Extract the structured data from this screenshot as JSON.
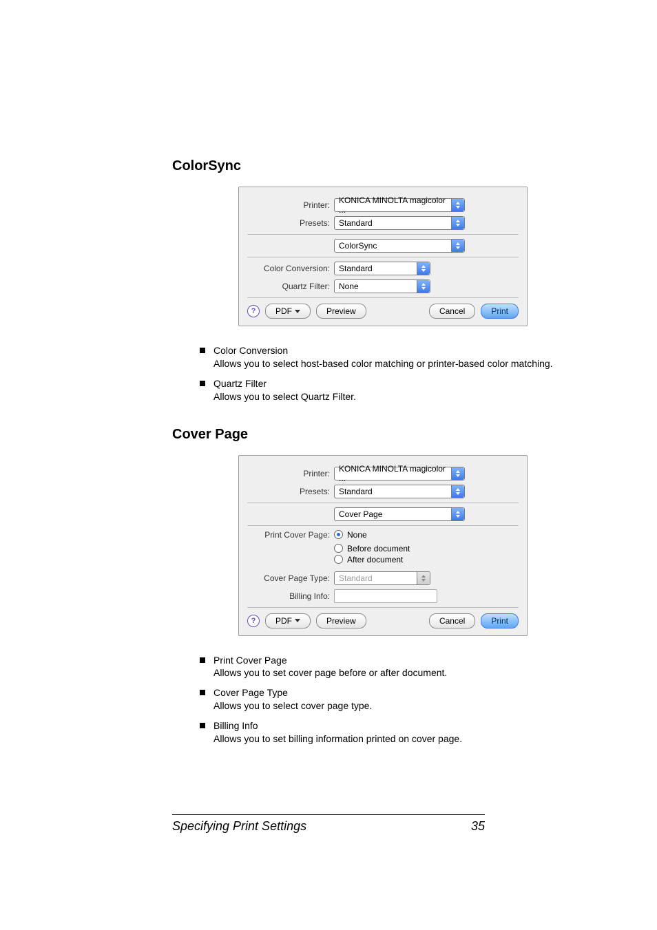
{
  "sections": {
    "colorsync": {
      "title": "ColorSync",
      "dialog": {
        "printer_label": "Printer:",
        "printer_value": "KONICA MINOLTA magicolor ...",
        "presets_label": "Presets:",
        "presets_value": "Standard",
        "pane_value": "ColorSync",
        "color_conversion_label": "Color Conversion:",
        "color_conversion_value": "Standard",
        "quartz_filter_label": "Quartz Filter:",
        "quartz_filter_value": "None",
        "help_glyph": "?",
        "pdf_label": "PDF",
        "preview_label": "Preview",
        "cancel_label": "Cancel",
        "print_label": "Print"
      },
      "bullets": [
        {
          "title": "Color Conversion",
          "desc": "Allows you to select host-based color matching or printer-based color matching."
        },
        {
          "title": "Quartz Filter",
          "desc": "Allows you to select Quartz Filter."
        }
      ]
    },
    "coverpage": {
      "title": "Cover Page",
      "dialog": {
        "printer_label": "Printer:",
        "printer_value": "KONICA MINOLTA magicolor ...",
        "presets_label": "Presets:",
        "presets_value": "Standard",
        "pane_value": "Cover Page",
        "print_cover_page_label": "Print Cover Page:",
        "option_none": "None",
        "option_before": "Before document",
        "option_after": "After document",
        "cover_page_type_label": "Cover Page Type:",
        "cover_page_type_value": "Standard",
        "billing_info_label": "Billing Info:",
        "billing_info_value": "",
        "help_glyph": "?",
        "pdf_label": "PDF",
        "preview_label": "Preview",
        "cancel_label": "Cancel",
        "print_label": "Print"
      },
      "bullets": [
        {
          "title": "Print Cover Page",
          "desc": "Allows you to set cover page before or after document."
        },
        {
          "title": "Cover Page Type",
          "desc": "Allows you to select cover page type."
        },
        {
          "title": "Billing Info",
          "desc": "Allows you to set billing information printed on cover page."
        }
      ]
    }
  },
  "footer": {
    "left": "Specifying Print Settings",
    "page": "35"
  }
}
